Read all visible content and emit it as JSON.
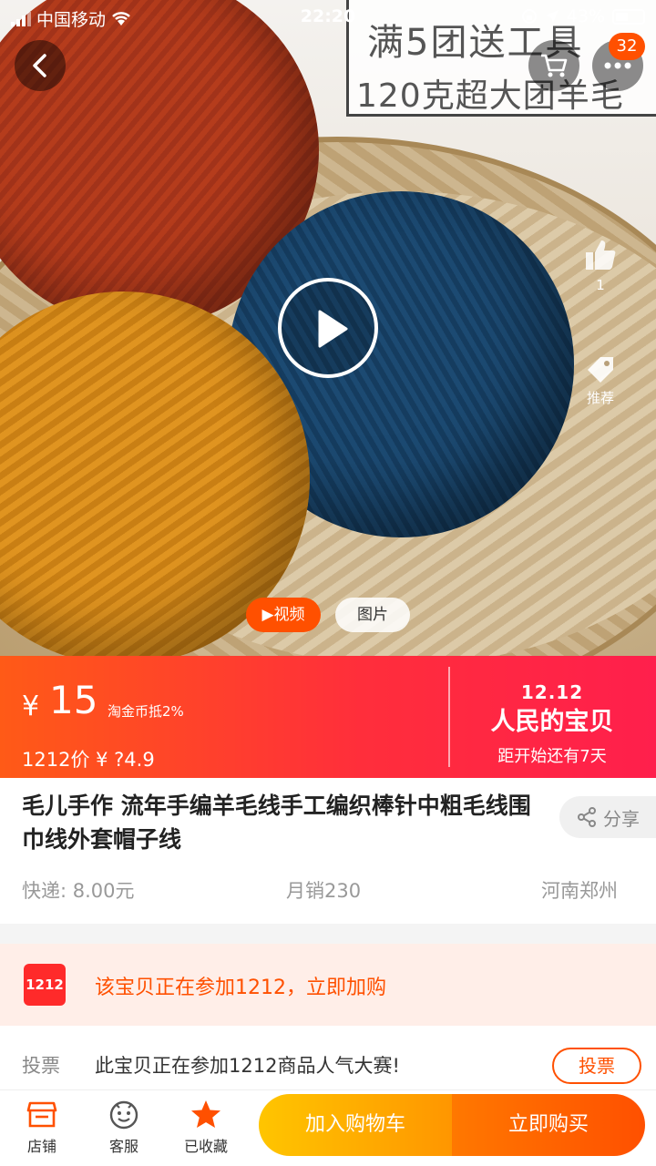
{
  "status_bar": {
    "carrier": "中国移动",
    "time": "22:20",
    "battery": "43%"
  },
  "hero": {
    "overlay_line1": "满5团送工具",
    "overlay_line2": "120克超大团羊毛",
    "cart_badge": "32",
    "like_count": "1",
    "recommend_label": "推荐",
    "tab_video": "▶视频",
    "tab_photo": "图片"
  },
  "price": {
    "currency": "¥",
    "value": "15",
    "coin_note": "淘金币抵2%",
    "price_1212": "1212价 ¥ ?4.9",
    "event_top": "12.12",
    "event_main": "人民的宝贝",
    "event_sub": "距开始还有7天"
  },
  "product": {
    "title": "毛儿手作 流年手编羊毛线手工编织棒针中粗毛线围巾线外套帽子线",
    "share_label": "分享",
    "shipping": "快递: 8.00元",
    "monthly_sales": "月销230",
    "location": "河南郑州"
  },
  "promo": {
    "logo": "1212",
    "text": "该宝贝正在参加1212，立即加购"
  },
  "vote": {
    "label": "投票",
    "text": "此宝贝正在参加1212商品人气大赛!",
    "button": "投票"
  },
  "bottom_bar": {
    "shop": "店铺",
    "service": "客服",
    "favorited": "已收藏",
    "add_to_cart": "加入购物车",
    "buy_now": "立即购买"
  },
  "colors": {
    "accent": "#ff5000",
    "cart_button": "#ffa000",
    "price_gradient_end": "#ff1f4c"
  }
}
